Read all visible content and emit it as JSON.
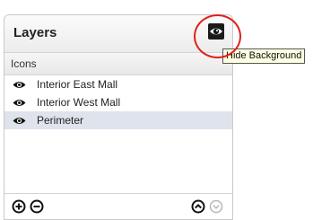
{
  "panel": {
    "title": "Layers",
    "background_toggle_icon": "eye-icon",
    "group_label": "Icons",
    "layers": [
      {
        "label": "Interior East Mall",
        "icon": "eye-icon",
        "selected": false
      },
      {
        "label": "Interior West Mall",
        "icon": "eye-icon",
        "selected": false
      },
      {
        "label": "Perimeter",
        "icon": "eye-icon",
        "selected": true
      }
    ],
    "footer": {
      "add_icon": "plus-circle-icon",
      "remove_icon": "minus-circle-icon",
      "move_up_icon": "chevron-up-circle-icon",
      "move_down_icon": "chevron-down-circle-icon"
    }
  },
  "tooltip": {
    "text": "Hide Background"
  },
  "colors": {
    "annotation": "#e0201b",
    "selected_row": "#dfe3ec",
    "tooltip_bg": "#ffffe1",
    "disabled_icon": "#b8b8b8"
  }
}
